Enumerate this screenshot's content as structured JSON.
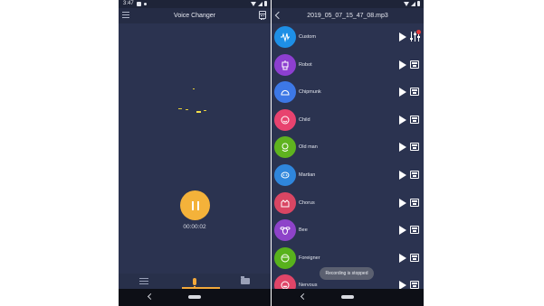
{
  "left": {
    "status": {
      "time": "3:47"
    },
    "title": "Voice Changer",
    "timer": "00:00:02"
  },
  "right": {
    "title": "2019_05_07_15_47_08.mp3",
    "effects": [
      {
        "label": "Custom",
        "color": "#1e8fe6",
        "icon": "waveform-icon"
      },
      {
        "label": "Robot",
        "color": "#8d3fd0",
        "icon": "robot-icon"
      },
      {
        "label": "Chipmunk",
        "color": "#3d78e6",
        "icon": "chipmunk-icon"
      },
      {
        "label": "Child",
        "color": "#e8436f",
        "icon": "child-icon"
      },
      {
        "label": "Old man",
        "color": "#5fb31f",
        "icon": "old-man-icon"
      },
      {
        "label": "Martian",
        "color": "#2f86dc",
        "icon": "martian-icon"
      },
      {
        "label": "Chorus",
        "color": "#d94663",
        "icon": "chorus-icon"
      },
      {
        "label": "Bee",
        "color": "#8e43c9",
        "icon": "bee-icon"
      },
      {
        "label": "Foreigner",
        "color": "#58b21c",
        "icon": "foreigner-icon"
      },
      {
        "label": "Nervous",
        "color": "#e04568",
        "icon": "nervous-icon"
      }
    ],
    "toast": "Recording is stopped"
  },
  "colors": {
    "accent": "#f4b23a",
    "background": "#2b3350"
  }
}
